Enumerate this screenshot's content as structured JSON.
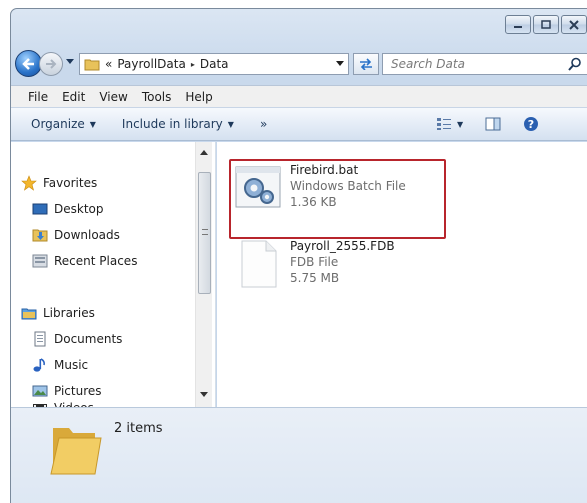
{
  "window": {
    "caption_buttons": [
      "minimize-icon",
      "maximize-icon",
      "close-icon"
    ]
  },
  "address": {
    "overflow": "«",
    "crumbs": [
      "PayrollData",
      "Data"
    ],
    "separator": "▸"
  },
  "search": {
    "placeholder": "Search Data"
  },
  "menu": [
    "File",
    "Edit",
    "View",
    "Tools",
    "Help"
  ],
  "commands": {
    "organize": "Organize",
    "include": "Include in library",
    "more": "»"
  },
  "nav": {
    "favorites": "Favorites",
    "desktop": "Desktop",
    "downloads": "Downloads",
    "recent": "Recent Places",
    "libraries": "Libraries",
    "documents": "Documents",
    "music": "Music",
    "pictures": "Pictures",
    "videos": "Videos"
  },
  "files": [
    {
      "name": "Firebird.bat",
      "type": "Windows Batch File",
      "size": "1.36 KB"
    },
    {
      "name": "Payroll_2555.FDB",
      "type": "FDB File",
      "size": "5.75 MB"
    }
  ],
  "status": {
    "count": "2 items"
  },
  "colors": {
    "highlight": "#b8252c",
    "accent": "#2a73c9"
  }
}
